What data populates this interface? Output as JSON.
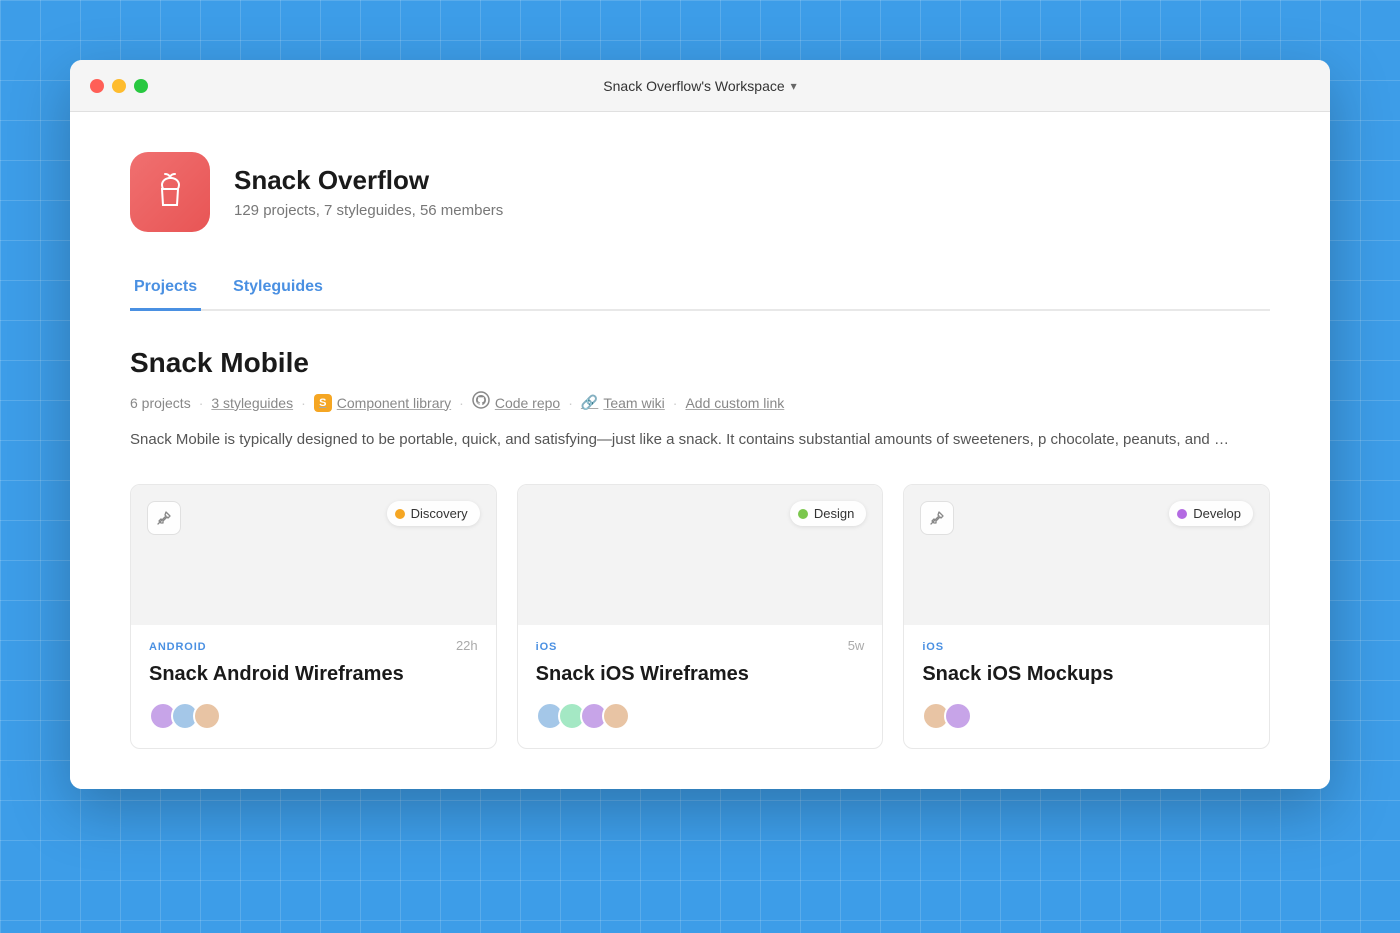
{
  "titlebar": {
    "workspace_label": "Snack Overflow's Workspace",
    "chevron": "▾"
  },
  "org": {
    "name": "Snack Overflow",
    "stats": "129 projects, 7 styleguides, 56 members"
  },
  "tabs": [
    {
      "id": "projects",
      "label": "Projects",
      "active": true
    },
    {
      "id": "styleguides",
      "label": "Styleguides",
      "active": false
    }
  ],
  "team": {
    "name": "Snack Mobile",
    "projects_count": "6 projects",
    "styleguides_count": "3 styleguides",
    "links": [
      {
        "label": "Component library",
        "icon": "zeplin-icon"
      },
      {
        "label": "Code repo",
        "icon": "github-icon"
      },
      {
        "label": "Team wiki",
        "icon": "link-icon"
      },
      {
        "label": "Add custom link",
        "icon": "add-icon"
      }
    ],
    "description": "Snack Mobile is typically designed to be portable, quick, and satisfying—just like a snack. It contains substantial amounts of sweeteners, p chocolate, peanuts, and specially-designed flavors (such as flavored potato chips)."
  },
  "projects": [
    {
      "id": "project-1",
      "platform": "ANDROID",
      "platform_color": "#4a90e2",
      "title": "Snack Android Wireframes",
      "time": "22h",
      "status_label": "Discovery",
      "status_color": "#f5a623",
      "pinned": false
    },
    {
      "id": "project-2",
      "platform": "iOS",
      "platform_color": "#4a90e2",
      "title": "Snack iOS Wireframes",
      "time": "5w",
      "status_label": "Design",
      "status_color": "#7bc74d",
      "pinned": false
    },
    {
      "id": "project-3",
      "platform": "iOS",
      "platform_color": "#4a90e2",
      "title": "Snack iOS Mockups",
      "time": "",
      "status_label": "Develop",
      "status_color": "#b36ae2",
      "pinned": false
    }
  ],
  "icons": {
    "unpin": "🖇",
    "zeplin": "S",
    "github": "⊙",
    "link": "⛓",
    "add": "+"
  }
}
